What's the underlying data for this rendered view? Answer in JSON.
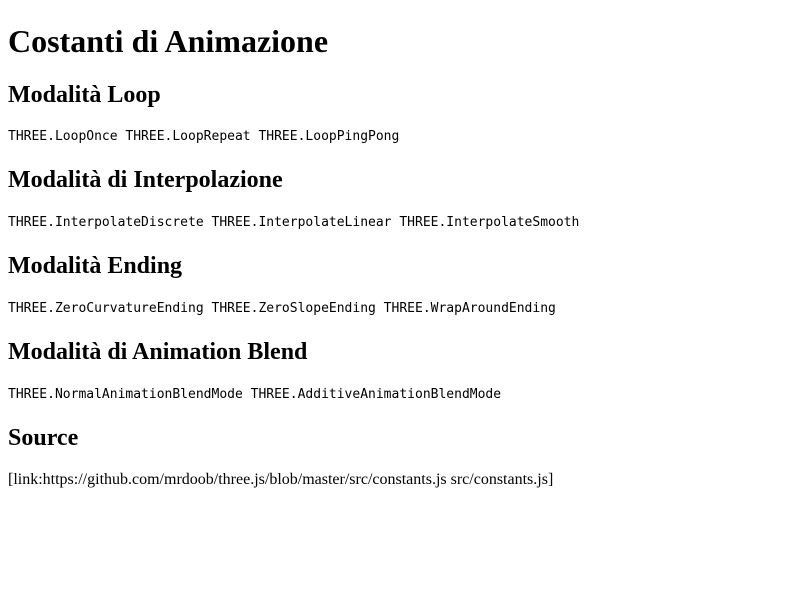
{
  "title": "Costanti di Animazione",
  "sections": [
    {
      "heading": "Modalità Loop",
      "content": "THREE.LoopOnce THREE.LoopRepeat THREE.LoopPingPong"
    },
    {
      "heading": "Modalità di Interpolazione",
      "content": "THREE.InterpolateDiscrete THREE.InterpolateLinear THREE.InterpolateSmooth"
    },
    {
      "heading": "Modalità Ending",
      "content": "THREE.ZeroCurvatureEnding THREE.ZeroSlopeEnding THREE.WrapAroundEnding"
    },
    {
      "heading": "Modalità di Animation Blend",
      "content": "THREE.NormalAnimationBlendMode THREE.AdditiveAnimationBlendMode"
    },
    {
      "heading": "Source",
      "content": "[link:https://github.com/mrdoob/three.js/blob/master/src/constants.js src/constants.js]"
    }
  ]
}
